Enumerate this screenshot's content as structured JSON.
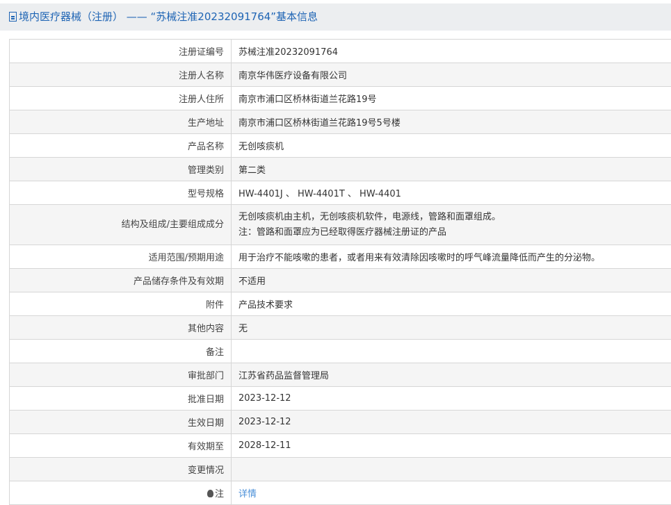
{
  "header": {
    "title": "境内医疗器械（注册） —— “苏械注准20232091764”基本信息"
  },
  "rows": [
    {
      "label": "注册证编号",
      "value": "苏械注准20232091764"
    },
    {
      "label": "注册人名称",
      "value": "南京华伟医疗设备有限公司"
    },
    {
      "label": "注册人住所",
      "value": "南京市浦口区桥林街道兰花路19号"
    },
    {
      "label": "生产地址",
      "value": "南京市浦口区桥林街道兰花路19号5号楼"
    },
    {
      "label": "产品名称",
      "value": "无创咳痰机"
    },
    {
      "label": "管理类别",
      "value": "第二类"
    },
    {
      "label": "型号规格",
      "value": "HW-4401J 、 HW-4401T 、 HW-4401"
    },
    {
      "label": "结构及组成/主要组成成分",
      "value": "无创咳痰机由主机，无创咳痰机软件，电源线，管路和面罩组成。",
      "value2": "注：管路和面罩应为已经取得医疗器械注册证的产品"
    },
    {
      "label": "适用范围/预期用途",
      "value": "用于治疗不能咳嗽的患者，或者用来有效清除因咳嗽时的呼气峰流量降低而产生的分泌物。"
    },
    {
      "label": "产品储存条件及有效期",
      "value": "不适用"
    },
    {
      "label": "附件",
      "value": "产品技术要求"
    },
    {
      "label": "其他内容",
      "value": "无"
    },
    {
      "label": "备注",
      "value": ""
    },
    {
      "label": "审批部门",
      "value": "江苏省药品监督管理局"
    },
    {
      "label": "批准日期",
      "value": "2023-12-12"
    },
    {
      "label": "生效日期",
      "value": "2023-12-12"
    },
    {
      "label": "有效期至",
      "value": "2028-12-11"
    },
    {
      "label": "变更情况",
      "value": ""
    },
    {
      "label": "注",
      "value": "详情"
    }
  ]
}
